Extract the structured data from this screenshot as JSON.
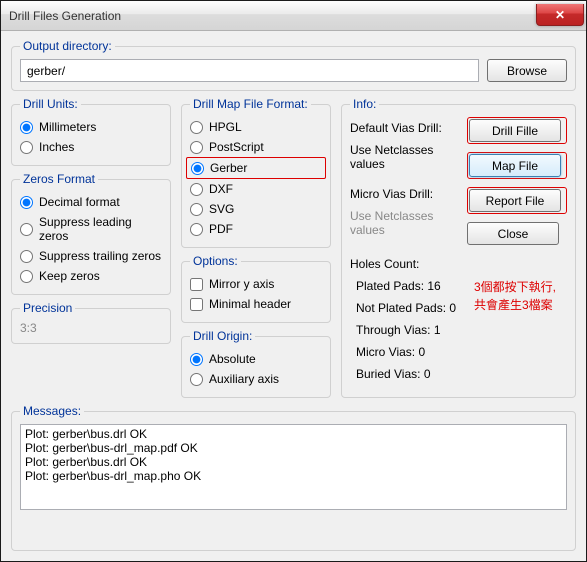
{
  "window": {
    "title": "Drill Files Generation"
  },
  "output": {
    "label": "Output directory:",
    "value": "gerber/",
    "browse": "Browse"
  },
  "units": {
    "label": "Drill Units:",
    "mm": "Millimeters",
    "in": "Inches",
    "selected": "mm"
  },
  "zeros": {
    "label": "Zeros Format",
    "decimal": "Decimal format",
    "sup_lead": "Suppress leading zeros",
    "sup_trail": "Suppress trailing zeros",
    "keep": "Keep zeros",
    "selected": "decimal"
  },
  "precision": {
    "label": "Precision",
    "value": "3:3"
  },
  "map": {
    "label": "Drill Map File Format:",
    "hpgl": "HPGL",
    "ps": "PostScript",
    "gerber": "Gerber",
    "dxf": "DXF",
    "svg": "SVG",
    "pdf": "PDF",
    "selected": "gerber"
  },
  "options": {
    "label": "Options:",
    "mirror": "Mirror y axis",
    "minimal": "Minimal header"
  },
  "origin": {
    "label": "Drill Origin:",
    "abs": "Absolute",
    "aux": "Auxiliary axis",
    "selected": "abs"
  },
  "info": {
    "label": "Info:",
    "def_vias": "Default Vias Drill:",
    "use_net1": "Use Netclasses values",
    "micro_vias": "Micro Vias Drill:",
    "use_net2": "Use Netclasses values",
    "holes_label": "Holes Count:",
    "holes": {
      "plated": "Plated Pads: 16",
      "notplated": "Not Plated Pads: 0",
      "through": "Through Vias: 1",
      "micro": "Micro Vias: 0",
      "buried": "Buried Vias: 0"
    }
  },
  "buttons": {
    "drill": "Drill Fille",
    "map": "Map File",
    "report": "Report File",
    "close": "Close"
  },
  "messages": {
    "label": "Messages:",
    "text": "Plot: gerber\\bus.drl OK\nPlot: gerber\\bus-drl_map.pdf OK\nPlot: gerber\\bus.drl OK\nPlot: gerber\\bus-drl_map.pho OK"
  },
  "annotation": {
    "line1": "3個都按下執行,",
    "line2": "共會產生3檔案"
  }
}
